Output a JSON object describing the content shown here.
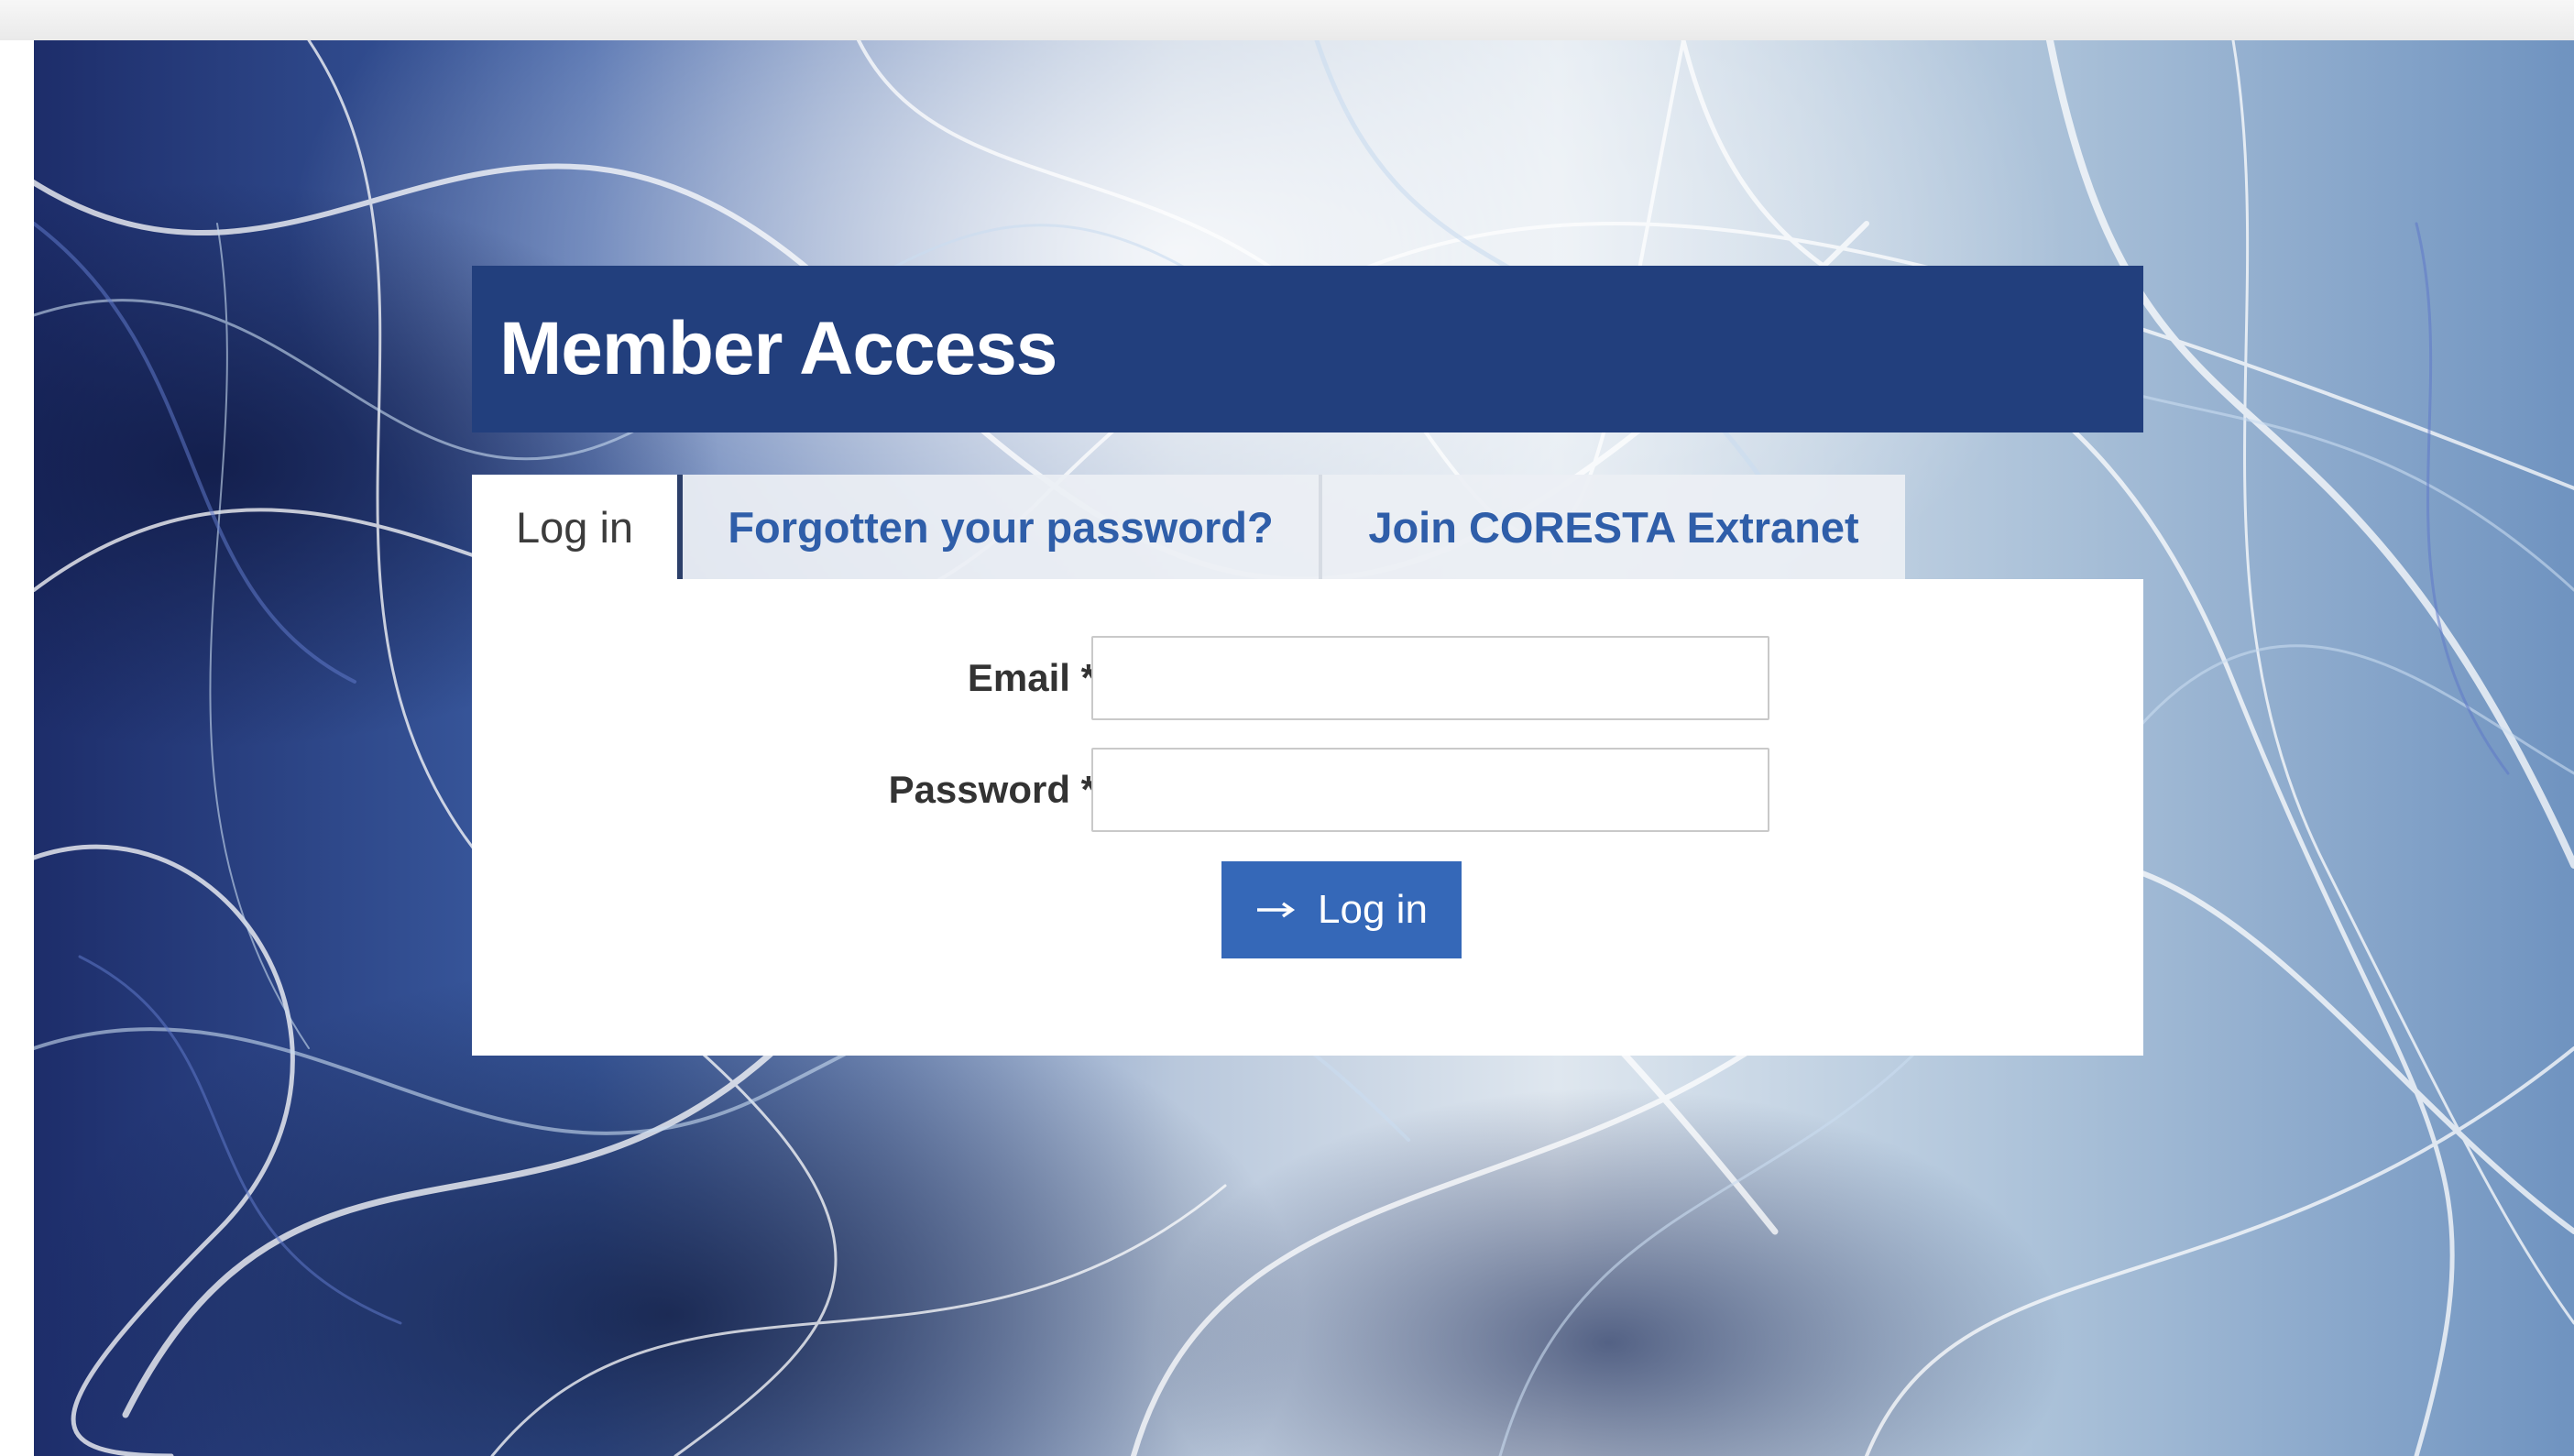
{
  "panel": {
    "title": "Member Access"
  },
  "tabs": [
    {
      "label": "Log in",
      "active": true
    },
    {
      "label": "Forgotten your password?",
      "active": false
    },
    {
      "label": "Join CORESTA Extranet",
      "active": false
    }
  ],
  "form": {
    "email_label": "Email *",
    "email_value": "",
    "password_label": "Password *",
    "password_value": "",
    "submit_label": "Log in",
    "submit_icon": "arrow-right-icon"
  },
  "colors": {
    "header_bg": "#223f7d",
    "tab_link": "#2f5ea9",
    "button_bg": "#3568b8",
    "background_dark": "#1e2f6e",
    "background_light": "#e9f0f7"
  }
}
